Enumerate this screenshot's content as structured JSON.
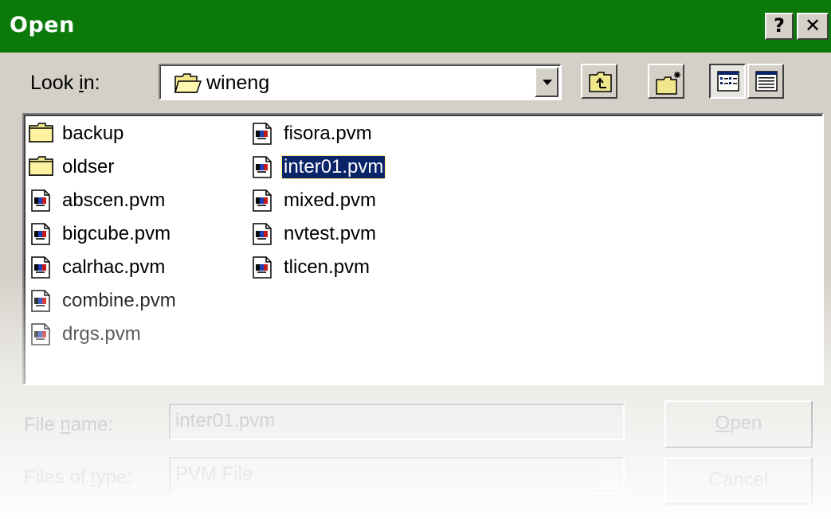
{
  "window": {
    "title": "Open",
    "help_glyph": "?",
    "close_glyph": "✕"
  },
  "look_in": {
    "label_pre": "Look ",
    "label_ul": "i",
    "label_post": "n:",
    "value": "wineng"
  },
  "toolbar": {
    "icons": [
      "up-one-level-icon",
      "create-new-folder-icon",
      "list-view-icon",
      "details-view-icon"
    ]
  },
  "files": {
    "column1": [
      {
        "name": "backup",
        "type": "folder"
      },
      {
        "name": "oldser",
        "type": "folder"
      },
      {
        "name": "abscen.pvm",
        "type": "pvm"
      },
      {
        "name": "bigcube.pvm",
        "type": "pvm"
      },
      {
        "name": "calrhac.pvm",
        "type": "pvm"
      },
      {
        "name": "combine.pvm",
        "type": "pvm"
      },
      {
        "name": "drgs.pvm",
        "type": "pvm"
      }
    ],
    "column2": [
      {
        "name": "fisora.pvm",
        "type": "pvm"
      },
      {
        "name": "inter01.pvm",
        "type": "pvm",
        "selected": true
      },
      {
        "name": "mixed.pvm",
        "type": "pvm"
      },
      {
        "name": "nvtest.pvm",
        "type": "pvm"
      },
      {
        "name": "tlicen.pvm",
        "type": "pvm"
      }
    ]
  },
  "filename": {
    "label_pre": "File ",
    "label_ul": "n",
    "label_post": "ame:",
    "value": "inter01.pvm"
  },
  "filetype": {
    "label_pre": "Files of ",
    "label_ul": "t",
    "label_post": "ype:",
    "value": "PVM File"
  },
  "buttons": {
    "open_ul": "O",
    "open_rest": "pen",
    "cancel": "Cancel"
  },
  "colors": {
    "titlebar": "#0b7a0b",
    "selection": "#0a246a",
    "face": "#d4d0c8"
  }
}
